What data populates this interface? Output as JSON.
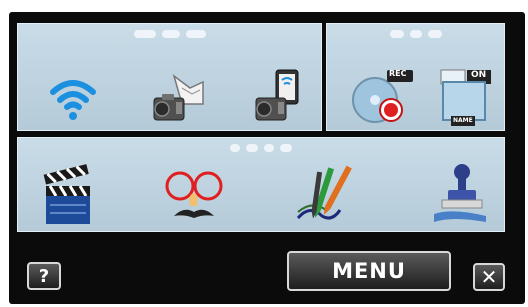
{
  "panels": {
    "top_left": {
      "items": [
        {
          "name": "wifi-icon"
        },
        {
          "name": "camera-network-icon"
        },
        {
          "name": "smartphone-camera-icon"
        }
      ]
    },
    "top_right": {
      "items": [
        {
          "name": "rec-disc-icon",
          "badge": "REC"
        },
        {
          "name": "date-name-icon",
          "badge": "ON",
          "tag": "NAME"
        }
      ]
    },
    "bottom": {
      "items": [
        {
          "name": "clapperboard-icon"
        },
        {
          "name": "face-glasses-icon"
        },
        {
          "name": "pens-icon"
        },
        {
          "name": "stamp-icon"
        }
      ]
    }
  },
  "buttons": {
    "help": "?",
    "menu": "MENU",
    "close": "✕"
  },
  "colors": {
    "panel_top": "#c9dce8",
    "wifi_blue": "#1b8fe0",
    "accent_red": "#e02020"
  }
}
